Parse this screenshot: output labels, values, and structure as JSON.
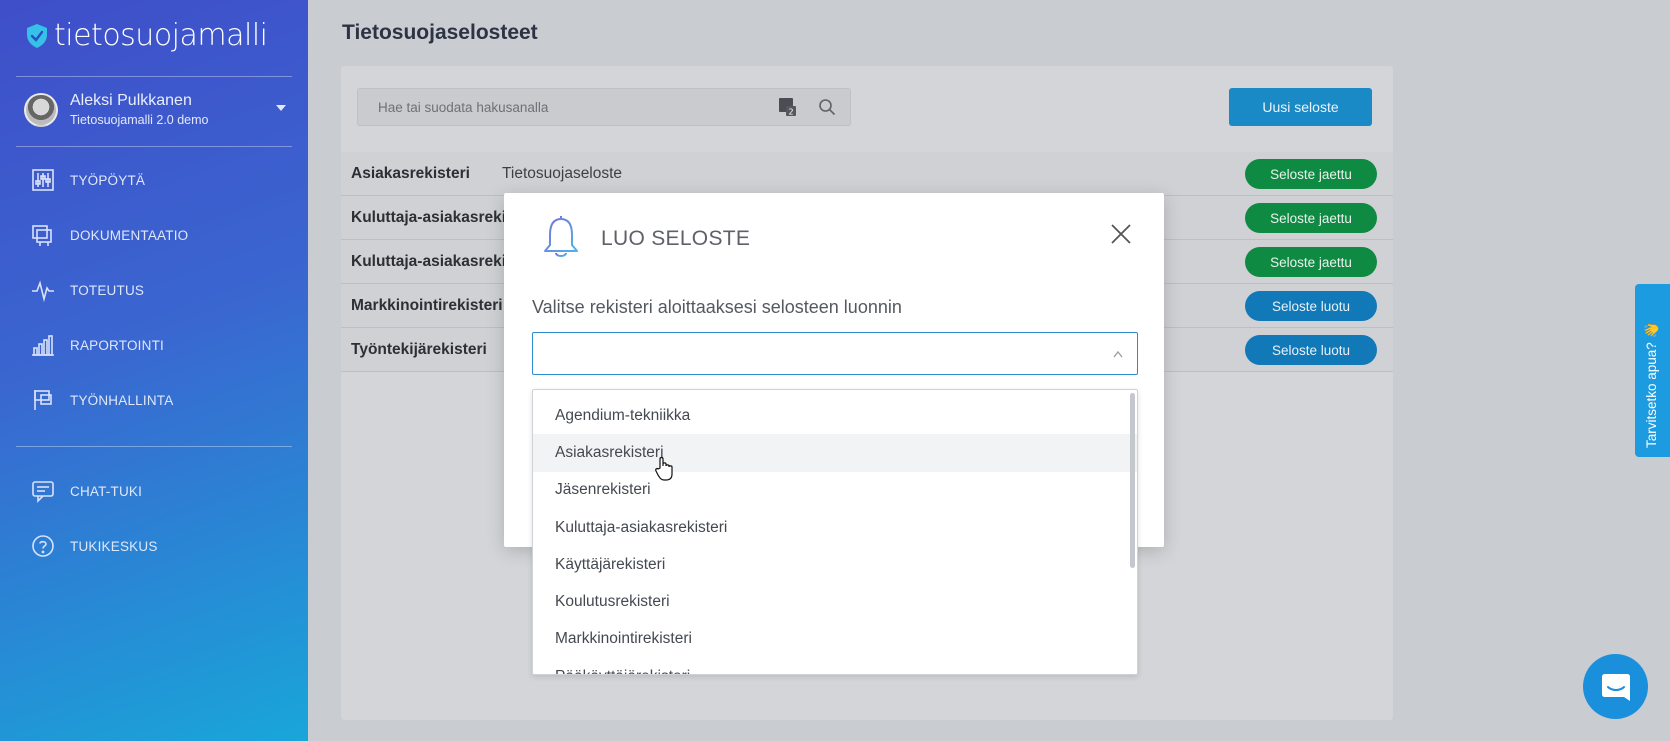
{
  "app": {
    "logo_text": "tietosuojamalli"
  },
  "user": {
    "name": "Aleksi Pulkkanen",
    "org": "Tietosuojamalli 2.0 demo"
  },
  "nav": {
    "primary": [
      {
        "label": "TYÖPÖYTÄ",
        "icon": "sliders-icon"
      },
      {
        "label": "DOKUMENTAATIO",
        "icon": "documents-icon"
      },
      {
        "label": "TOTEUTUS",
        "icon": "pulse-icon"
      },
      {
        "label": "RAPORTOINTI",
        "icon": "bar-chart-icon"
      },
      {
        "label": "TYÖNHALLINTA",
        "icon": "task-flag-icon"
      }
    ],
    "secondary": [
      {
        "label": "CHAT-TUKI",
        "icon": "chat-icon"
      },
      {
        "label": "TUKIKESKUS",
        "icon": "help-circle-icon"
      }
    ]
  },
  "page": {
    "title": "Tietosuojaselosteet"
  },
  "search": {
    "placeholder": "Hae tai suodata hakusanalla"
  },
  "toolbar": {
    "new_label": "Uusi seloste"
  },
  "rows": [
    {
      "name": "Asiakasrekisteri",
      "type": "Tietosuojaseloste",
      "status": "Seloste jaettu",
      "status_kind": "shared"
    },
    {
      "name": "Kuluttaja-asiakasrekisteri",
      "type": "",
      "status": "Seloste jaettu",
      "status_kind": "shared"
    },
    {
      "name": "Kuluttaja-asiakasrekisteri",
      "type": "",
      "status": "Seloste jaettu",
      "status_kind": "shared"
    },
    {
      "name": "Markkinointirekisteri",
      "type": "",
      "status": "Seloste luotu",
      "status_kind": "created"
    },
    {
      "name": "Työntekijärekisteri",
      "type": "",
      "status": "Seloste luotu",
      "status_kind": "created"
    }
  ],
  "modal": {
    "title": "LUO SELOSTE",
    "label": "Valitse rekisteri aloittaaksesi selosteen luonnin",
    "select_value": ""
  },
  "dropdown": {
    "options": [
      "Agendium-tekniikka",
      "Asiakasrekisteri",
      "Jäsenrekisteri",
      "Kuluttaja-asiakasrekisteri",
      "Käyttäjärekisteri",
      "Koulutusrekisteri",
      "Markkinointirekisteri",
      "Pääkäyttäjärekisteri"
    ],
    "hovered": "Asiakasrekisteri"
  },
  "help": {
    "tab_label": "Tarvitsetko apua? 👋"
  },
  "colors": {
    "accent": "#1a8ac6",
    "shared": "#0f8a43",
    "created": "#1279b8",
    "select_border": "#2f8bd0"
  }
}
